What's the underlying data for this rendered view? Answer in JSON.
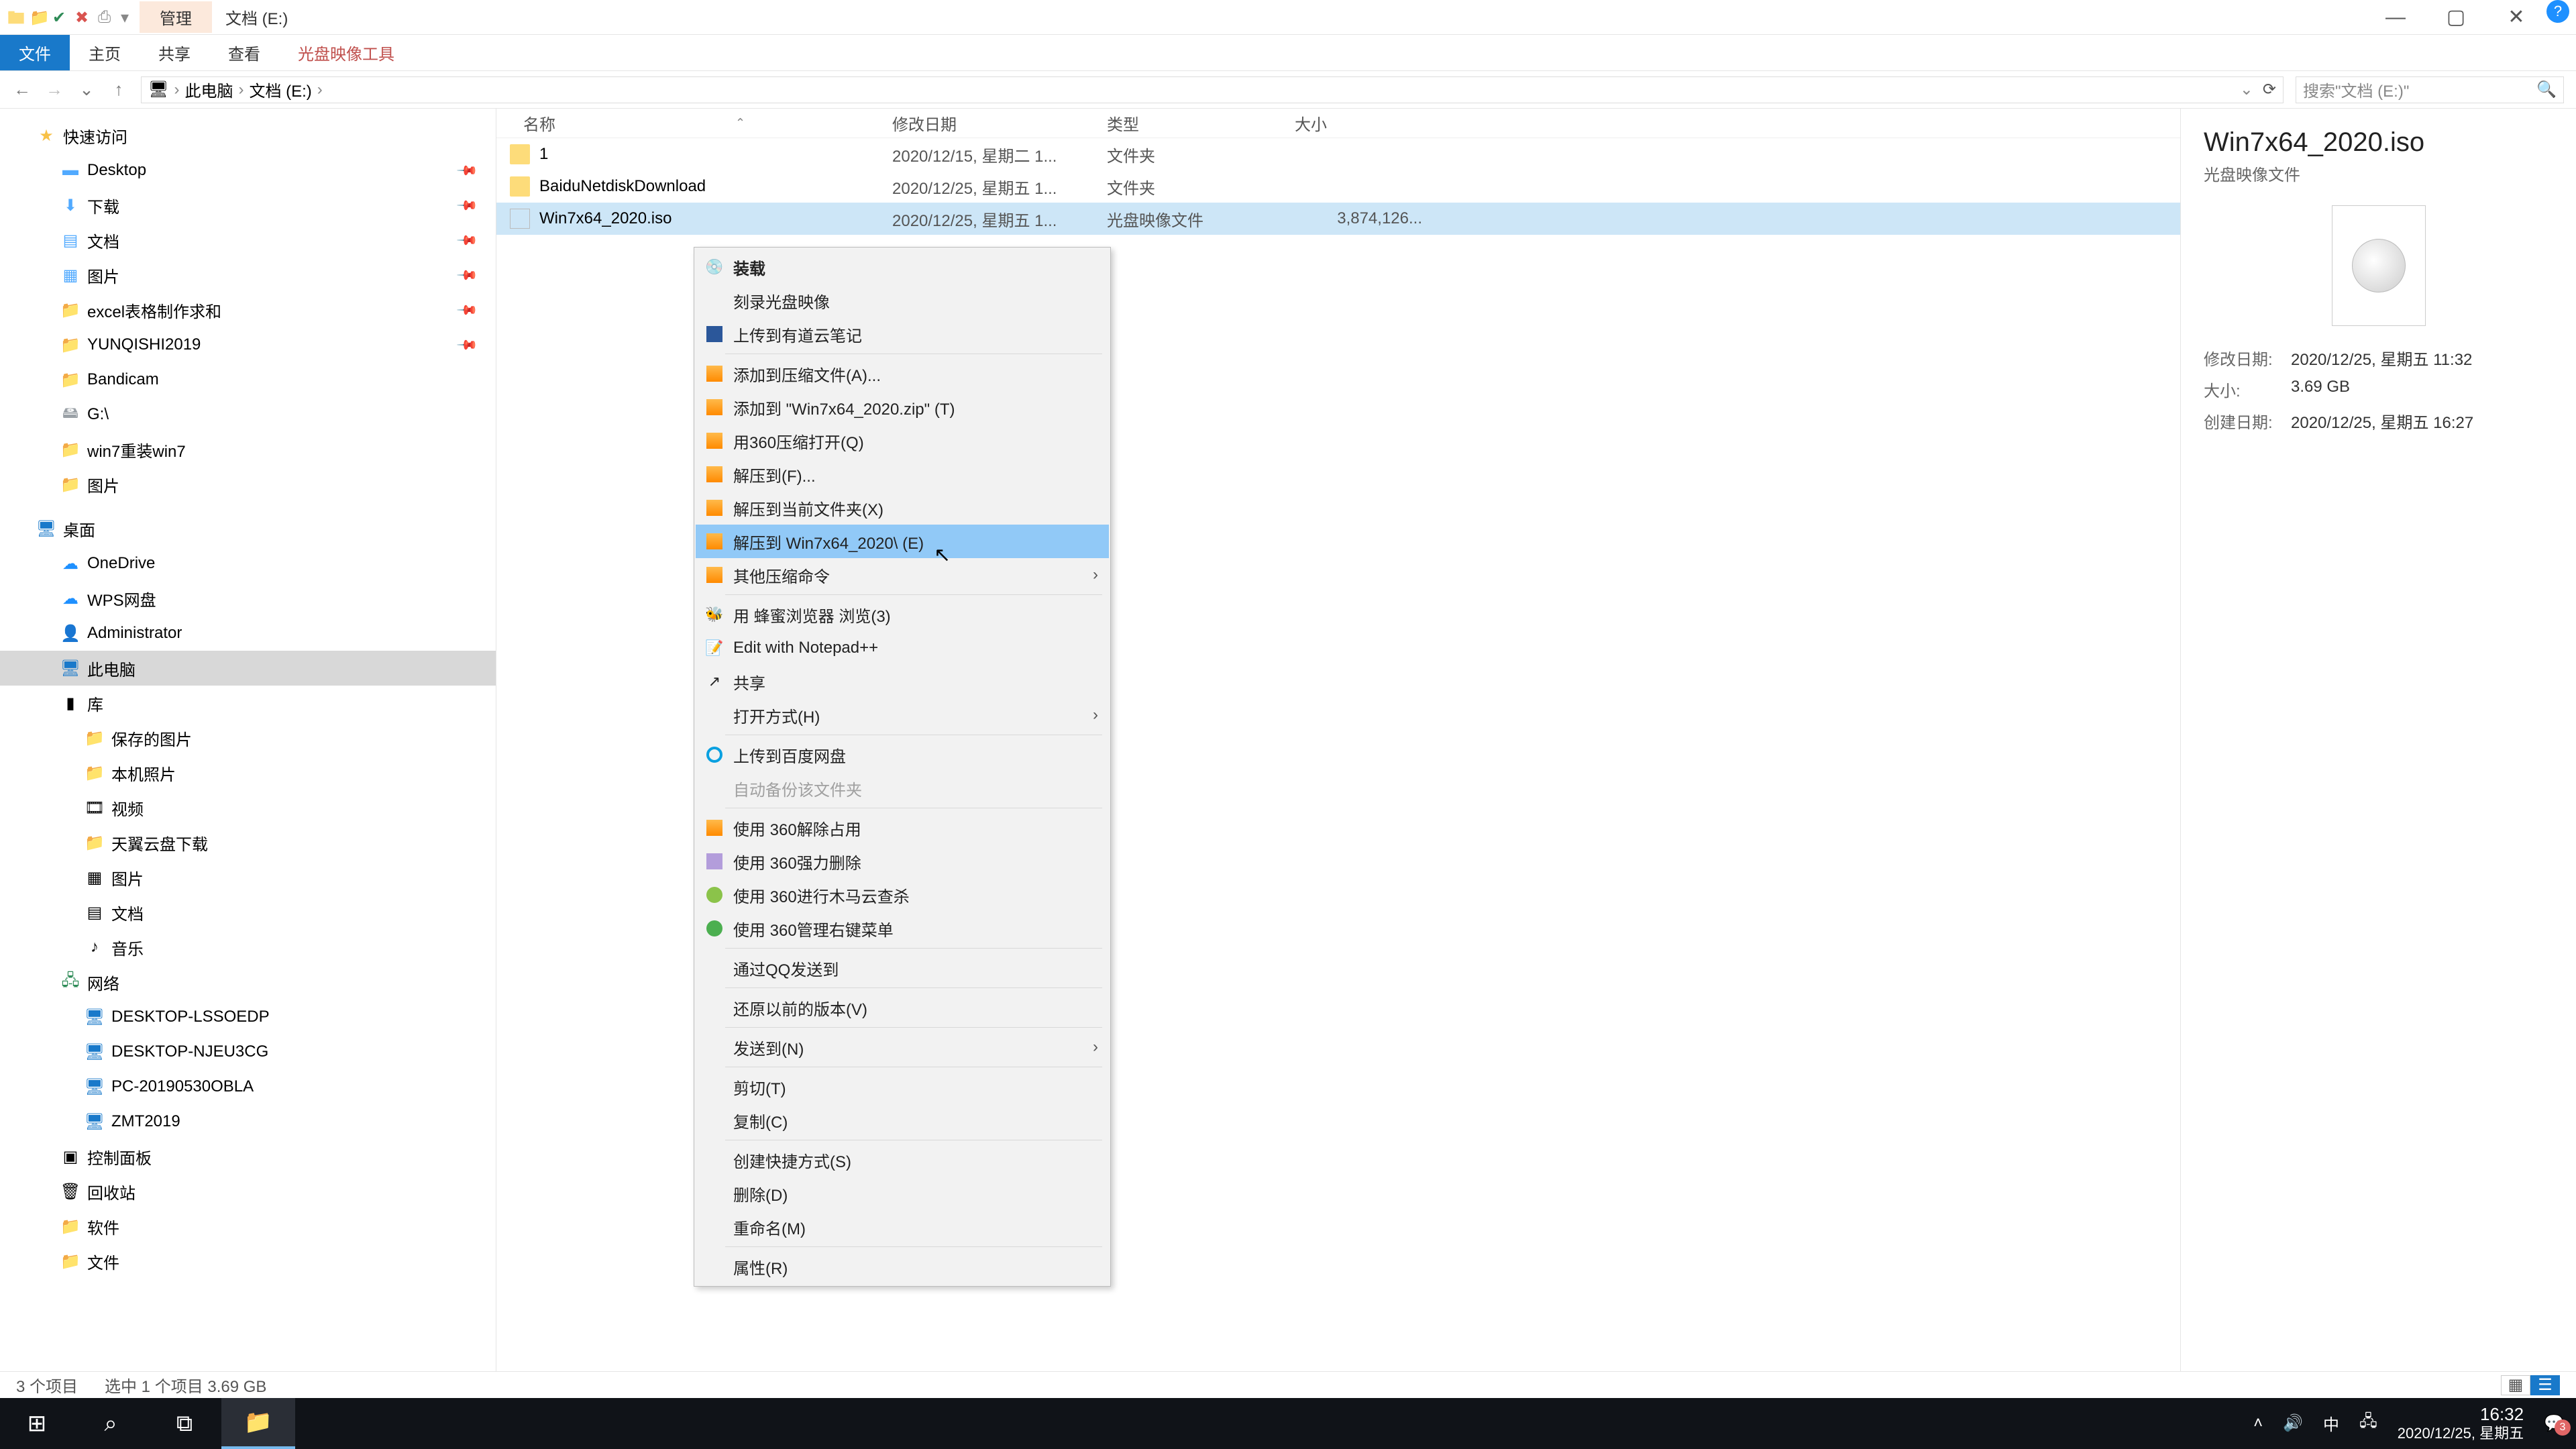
{
  "title": {
    "manage": "管理",
    "caption": "文档 (E:)"
  },
  "ribbon": {
    "file": "文件",
    "home": "主页",
    "share": "共享",
    "view": "查看",
    "disc_tool": "光盘映像工具"
  },
  "breadcrumb": {
    "pc": "此电脑",
    "drive": "文档 (E:)"
  },
  "search": {
    "placeholder": "搜索\"文档 (E:)\""
  },
  "tree": {
    "quick": "快速访问",
    "desktop": "Desktop",
    "downloads": "下载",
    "documents": "文档",
    "pictures": "图片",
    "excel": "excel表格制作求和",
    "yunqishi": "YUNQISHI2019",
    "bandicam": "Bandicam",
    "gdrive": "G:\\",
    "win7re": "win7重装win7",
    "pictures2": "图片",
    "deskgroup": "桌面",
    "onedrive": "OneDrive",
    "wps": "WPS网盘",
    "admin": "Administrator",
    "thispc": "此电脑",
    "library": "库",
    "saved_pics": "保存的图片",
    "local_pics": "本机照片",
    "video": "视频",
    "tianyi": "天翼云盘下载",
    "pics3": "图片",
    "docs2": "文档",
    "music": "音乐",
    "network": "网络",
    "pc1": "DESKTOP-LSSOEDP",
    "pc2": "DESKTOP-NJEU3CG",
    "pc3": "PC-20190530OBLA",
    "pc4": "ZMT2019",
    "ctrlpanel": "控制面板",
    "recycle": "回收站",
    "soft": "软件",
    "files": "文件"
  },
  "columns": {
    "name": "名称",
    "date": "修改日期",
    "type": "类型",
    "size": "大小"
  },
  "rows": [
    {
      "name": "1",
      "date": "2020/12/15, 星期二 1...",
      "type": "文件夹",
      "size": ""
    },
    {
      "name": "BaiduNetdiskDownload",
      "date": "2020/12/25, 星期五 1...",
      "type": "文件夹",
      "size": ""
    },
    {
      "name": "Win7x64_2020.iso",
      "date": "2020/12/25, 星期五 1...",
      "type": "光盘映像文件",
      "size": "3,874,126..."
    }
  ],
  "ctx": {
    "mount": "装载",
    "burn": "刻录光盘映像",
    "youdao": "上传到有道云笔记",
    "add_arch": "添加到压缩文件(A)...",
    "add_zip": "添加到 \"Win7x64_2020.zip\" (T)",
    "open360": "用360压缩打开(Q)",
    "extract_to": "解压到(F)...",
    "extract_here": "解压到当前文件夹(X)",
    "extract_named": "解压到 Win7x64_2020\\ (E)",
    "other_arch": "其他压缩命令",
    "honey": "用 蜂蜜浏览器 浏览(3)",
    "npp": "Edit with Notepad++",
    "share": "共享",
    "openwith": "打开方式(H)",
    "baidu_up": "上传到百度网盘",
    "auto_backup": "自动备份该文件夹",
    "u360_unlock": "使用 360解除占用",
    "u360_force": "使用 360强力删除",
    "u360_scan": "使用 360进行木马云查杀",
    "u360_menu": "使用 360管理右键菜单",
    "qq_send": "通过QQ发送到",
    "restore": "还原以前的版本(V)",
    "sendto": "发送到(N)",
    "cut": "剪切(T)",
    "copy": "复制(C)",
    "shortcut": "创建快捷方式(S)",
    "delete": "删除(D)",
    "rename": "重命名(M)",
    "props": "属性(R)"
  },
  "preview": {
    "title": "Win7x64_2020.iso",
    "subtitle": "光盘映像文件",
    "mdate_l": "修改日期:",
    "mdate_v": "2020/12/25, 星期五 11:32",
    "size_l": "大小:",
    "size_v": "3.69 GB",
    "cdate_l": "创建日期:",
    "cdate_v": "2020/12/25, 星期五 16:27"
  },
  "status": {
    "count": "3 个项目",
    "selected": "选中 1 个项目  3.69 GB"
  },
  "taskbar": {
    "ime": "中",
    "time": "16:32",
    "date": "2020/12/25, 星期五",
    "notif": "3"
  }
}
